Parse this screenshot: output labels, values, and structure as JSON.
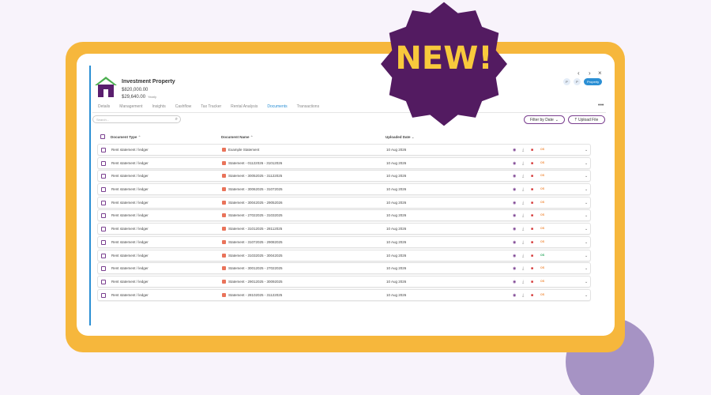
{
  "property": {
    "title": "Investment Property",
    "value": "$820,000.00",
    "rent": "$29,640.00",
    "rent_period": "Yearly"
  },
  "nav": {
    "prev": "‹",
    "next": "›",
    "close": "×"
  },
  "badges": [
    "P",
    "P",
    "Property"
  ],
  "tabs": [
    "Details",
    "Management",
    "Insights",
    "Cashflow",
    "Tax Tracker",
    "Rental Analysis",
    "Documents",
    "Transactions"
  ],
  "active_tab": "Documents",
  "more": "•••",
  "search": {
    "placeholder": "Search..."
  },
  "filter_button": "Filter by Date",
  "upload_button": "Upload File",
  "columns": {
    "type": "Document Type",
    "name": "Document Name",
    "date": "Uploaded Date"
  },
  "rows": [
    {
      "type": "Rent statement / ledger",
      "name": "Example Statement",
      "date": "10 Aug 2026",
      "tag": "OS"
    },
    {
      "type": "Rent statement / ledger",
      "name": "Statement - 01122026 - 31012026",
      "date": "10 Aug 2026",
      "tag": "OS"
    },
    {
      "type": "Rent statement / ledger",
      "name": "Statement - 30052025 - 31122025",
      "date": "10 Aug 2026",
      "tag": "OS"
    },
    {
      "type": "Rent statement / ledger",
      "name": "Statement - 30062025 - 31072025",
      "date": "10 Aug 2026",
      "tag": "OS"
    },
    {
      "type": "Rent statement / ledger",
      "name": "Statement - 30042025 - 29052026",
      "date": "10 Aug 2026",
      "tag": "OS"
    },
    {
      "type": "Rent statement / ledger",
      "name": "Statement - 27022025 - 31032025",
      "date": "10 Aug 2026",
      "tag": "OS"
    },
    {
      "type": "Rent statement / ledger",
      "name": "Statement - 31012025 - 28112025",
      "date": "10 Aug 2026",
      "tag": "OS"
    },
    {
      "type": "Rent statement / ledger",
      "name": "Statement - 31072025 - 29082025",
      "date": "10 Aug 2026",
      "tag": "OS"
    },
    {
      "type": "Rent statement / ledger",
      "name": "Statement - 31032025 - 30042025",
      "date": "10 Aug 2026",
      "tag": "OS"
    },
    {
      "type": "Rent statement / ledger",
      "name": "Statement - 30012025 - 27022025",
      "date": "10 Aug 2026",
      "tag": "OS"
    },
    {
      "type": "Rent statement / ledger",
      "name": "Statement - 29012025 - 30092025",
      "date": "10 Aug 2026",
      "tag": "OS"
    },
    {
      "type": "Rent statement / ledger",
      "name": "Statement - 28102025 - 31122025",
      "date": "10 Aug 2026",
      "tag": "OS"
    }
  ],
  "row_tag_colors": [
    "orange",
    "orange",
    "orange",
    "orange",
    "orange",
    "orange",
    "orange",
    "orange",
    "green",
    "orange",
    "orange",
    "orange"
  ],
  "starburst": {
    "text": "NEW!",
    "fill": "#531b61",
    "text_color": "#f8c93c"
  },
  "colors": {
    "accent": "#2b8fd4",
    "purple": "#7a3f8f",
    "frame": "#f6b73c",
    "circle": "#a693c4"
  }
}
